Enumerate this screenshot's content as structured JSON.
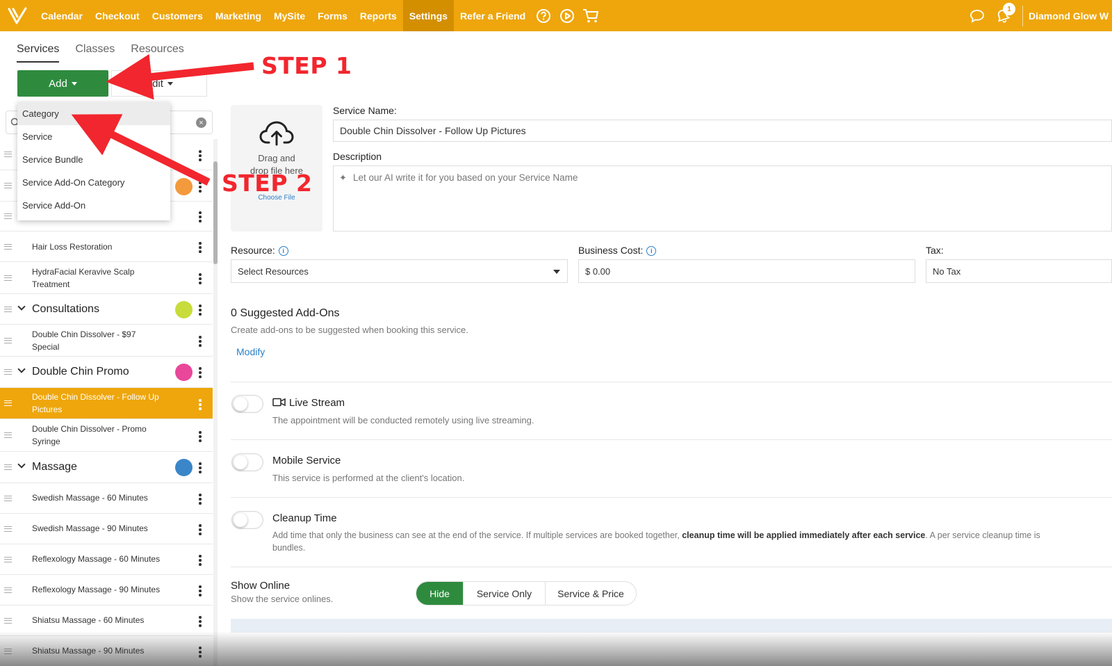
{
  "topnav": {
    "items": [
      "Calendar",
      "Checkout",
      "Customers",
      "Marketing",
      "MySite",
      "Forms",
      "Reports",
      "Settings",
      "Refer a Friend"
    ],
    "active": "Settings",
    "notification_count": "1",
    "business_name": "Diamond Glow W"
  },
  "tabs": [
    "Services",
    "Classes",
    "Resources"
  ],
  "toolbar": {
    "add_label": "Add",
    "edit_label": "Edit"
  },
  "search": {
    "value": "",
    "placeholder": ""
  },
  "add_menu": [
    "Category",
    "Service",
    "Service Bundle",
    "Service Add-On Category",
    "Service Add-On"
  ],
  "list": {
    "hair_loss": "Hair Loss Restoration",
    "hydrafacial": "HydraFacial Keravive Scalp Treatment",
    "cat_consultations": "Consultations",
    "dc97": "Double Chin Dissolver - $97 Special",
    "cat_dcpromo": "Double Chin Promo",
    "dc_follow": "Double Chin Dissolver - Follow Up Pictures",
    "dc_promo": "Double Chin Dissolver - Promo Syringe",
    "cat_massage": "Massage",
    "swedish60": "Swedish Massage - 60 Minutes",
    "swedish90": "Swedish Massage - 90 Minutes",
    "reflex60": "Reflexology Massage - 60 Minutes",
    "reflex90": "Reflexology Massage - 90 Minutes",
    "shiatsu60": "Shiatsu Massage - 60 Minutes",
    "shiatsu90": "Shiatsu Massage - 90 Minutes"
  },
  "category_colors": {
    "first": "#f39a3c",
    "consultations": "#c8dc3c",
    "double_chin_promo": "#e8479a",
    "massage": "#3a86c8"
  },
  "upload": {
    "text1": "Drag and",
    "text2": "drop file here",
    "choose": "Choose File"
  },
  "form": {
    "name_label": "Service Name:",
    "name_value": "Double Chin Dissolver - Follow Up Pictures",
    "desc_label": "Description",
    "desc_placeholder": "Let our AI write it for you based on your Service Name",
    "resource_label": "Resource:",
    "resource_value": "Select Resources",
    "cost_label": "Business Cost:",
    "cost_value": "$ 0.00",
    "tax_label": "Tax:",
    "tax_value": "No Tax"
  },
  "addons": {
    "title": "0  Suggested Add-Ons",
    "subtitle": "Create add-ons to be suggested when booking this service.",
    "modify": "Modify"
  },
  "live_stream": {
    "title": "Live Stream",
    "desc": "The appointment will be conducted remotely using live streaming."
  },
  "mobile": {
    "title": "Mobile Service",
    "desc": "This service is performed at the client's location."
  },
  "cleanup": {
    "title": "Cleanup Time",
    "desc_a": "Add time that only the business can see at the end of the service. If multiple services are booked together, ",
    "desc_bold": "cleanup time will be applied immediately after each service",
    "desc_b": ". A per service cleanup time is",
    "desc_line2": "bundles."
  },
  "show_online": {
    "title": "Show Online",
    "subtitle": "Show the service onlines.",
    "options": [
      "Hide",
      "Service Only",
      "Service & Price"
    ],
    "selected": "Hide"
  },
  "annotations": {
    "step1": "STEP 1",
    "step2": "STEP 2"
  },
  "colors": {
    "brand": "#eea60c",
    "green": "#2e8b3e",
    "annotation_red": "#f2262e",
    "link": "#2a7fc9"
  }
}
